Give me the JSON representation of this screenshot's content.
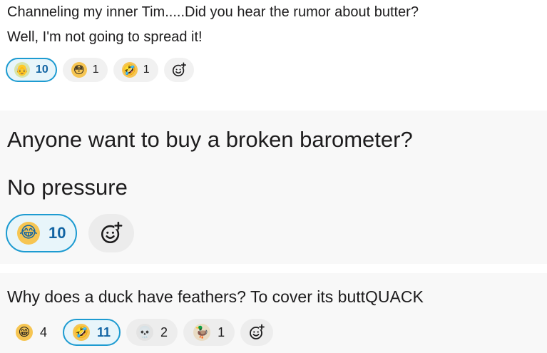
{
  "messages": [
    {
      "lines": [
        "Channeling my inner Tim.....Did you hear the rumor about butter?",
        "Well, I'm not going to spread it!"
      ],
      "reactions": [
        {
          "icon": "old-man-emoji",
          "glyph": "👴",
          "count": "10",
          "selected": true,
          "color": "#d8e4a8"
        },
        {
          "icon": "flushed-face-emoji",
          "glyph": "😳",
          "count": "1",
          "selected": false,
          "color": "#f6c552"
        },
        {
          "icon": "rolling-on-floor-laughing-emoji",
          "glyph": "🤣",
          "count": "1",
          "selected": false,
          "color": "#f6c552"
        }
      ],
      "add_reaction_icon": "add-reaction-icon"
    },
    {
      "lines": [
        "Anyone want to buy a broken barometer?",
        "No pressure"
      ],
      "reactions": [
        {
          "icon": "tears-of-joy-emoji",
          "glyph": "😂",
          "count": "10",
          "selected": true,
          "color": "#f6c552"
        }
      ],
      "add_reaction_icon": "add-reaction-icon"
    },
    {
      "lines": [
        "Why does a duck have feathers? To cover its buttQUACK"
      ],
      "reactions": [
        {
          "icon": "grinning-face-emoji",
          "glyph": "😁",
          "count": "4",
          "selected": false,
          "color": "#f6c552"
        },
        {
          "icon": "rolling-on-floor-laughing-emoji",
          "glyph": "🤣",
          "count": "11",
          "selected": true,
          "color": "#f6c552"
        },
        {
          "icon": "skull-emoji",
          "glyph": "💀",
          "count": "2",
          "selected": false,
          "color": "#e3e3e3"
        },
        {
          "icon": "duck-emoji",
          "glyph": "🦆",
          "count": "1",
          "selected": false,
          "color": "#e9dcc4"
        }
      ],
      "add_reaction_icon": "add-reaction-icon"
    }
  ],
  "colors": {
    "selected_border": "#1d9bd1",
    "selected_bg": "#e8f5fa",
    "selected_text": "#1264a3",
    "pill_bg": "#f1f1f1",
    "message_hover_bg": "#f8f8f8"
  }
}
